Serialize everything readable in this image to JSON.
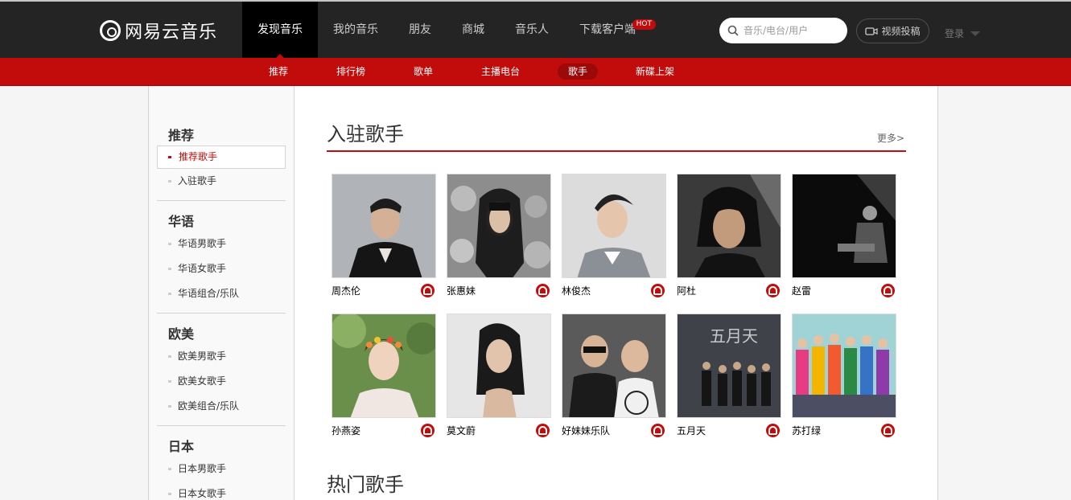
{
  "brand": {
    "logo_text": "网易云音乐"
  },
  "topnav": {
    "items": [
      {
        "label": "发现音乐",
        "active": true
      },
      {
        "label": "我的音乐"
      },
      {
        "label": "朋友"
      },
      {
        "label": "商城"
      },
      {
        "label": "音乐人"
      },
      {
        "label": "下载客户端",
        "badge": "HOT"
      }
    ],
    "search_placeholder": "音乐/电台/用户",
    "upload_label": "视频投稿",
    "login_label": "登录"
  },
  "subnav": {
    "items": [
      {
        "label": "推荐"
      },
      {
        "label": "排行榜"
      },
      {
        "label": "歌单"
      },
      {
        "label": "主播电台"
      },
      {
        "label": "歌手",
        "active": true
      },
      {
        "label": "新碟上架"
      }
    ]
  },
  "sidebar": {
    "groups": [
      {
        "title": "推荐",
        "items": [
          "推荐歌手",
          "入驻歌手"
        ]
      },
      {
        "title": "华语",
        "items": [
          "华语男歌手",
          "华语女歌手",
          "华语组合/乐队"
        ]
      },
      {
        "title": "欧美",
        "items": [
          "欧美男歌手",
          "欧美女歌手",
          "欧美组合/乐队"
        ]
      },
      {
        "title": "日本",
        "items": [
          "日本男歌手",
          "日本女歌手"
        ]
      }
    ],
    "active_item": "推荐歌手"
  },
  "main": {
    "signed_section": {
      "title": "入驻歌手",
      "more": "更多>"
    },
    "artists": [
      {
        "name": "周杰伦"
      },
      {
        "name": "张惠妹"
      },
      {
        "name": "林俊杰"
      },
      {
        "name": "阿杜"
      },
      {
        "name": "赵雷"
      },
      {
        "name": "孙燕姿"
      },
      {
        "name": "莫文蔚"
      },
      {
        "name": "好妹妹乐队"
      },
      {
        "name": "五月天"
      },
      {
        "name": "苏打绿"
      }
    ],
    "hot_section": {
      "title": "热门歌手"
    }
  },
  "colors": {
    "accent": "#c20c0c",
    "topbar": "#242424",
    "sidebar_bg": "#f9f9f9"
  }
}
